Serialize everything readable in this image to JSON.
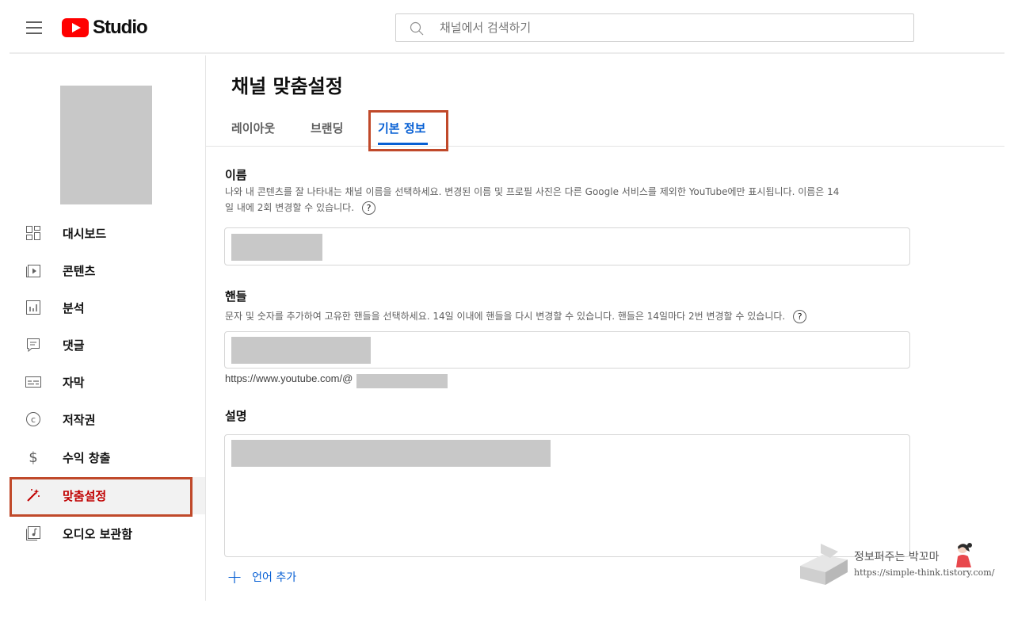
{
  "header": {
    "logo_text": "Studio",
    "search_placeholder": "채널에서 검색하기"
  },
  "sidebar": {
    "items": [
      {
        "label": "대시보드",
        "icon": "dashboard-icon"
      },
      {
        "label": "콘텐츠",
        "icon": "content-icon"
      },
      {
        "label": "분석",
        "icon": "analytics-icon"
      },
      {
        "label": "댓글",
        "icon": "comments-icon"
      },
      {
        "label": "자막",
        "icon": "subtitles-icon"
      },
      {
        "label": "저작권",
        "icon": "copyright-icon"
      },
      {
        "label": "수익 창출",
        "icon": "monetization-icon"
      },
      {
        "label": "맞춤설정",
        "icon": "customization-icon",
        "active": true
      },
      {
        "label": "오디오 보관함",
        "icon": "audio-library-icon"
      }
    ]
  },
  "main": {
    "title": "채널 맞춤설정",
    "tabs": [
      {
        "label": "레이아웃"
      },
      {
        "label": "브랜딩"
      },
      {
        "label": "기본 정보",
        "active": true
      }
    ],
    "name_section": {
      "title": "이름",
      "description_line1": "나와 내 콘텐츠를 잘 나타내는 채널 이름을 선택하세요. 변경된 이름 및 프로필 사진은 다른 Google 서비스를 제외한 YouTube에만 표시됩니다. 이름은 14",
      "description_line2": "일 내에 2회 변경할 수 있습니다."
    },
    "handle_section": {
      "title": "핸들",
      "description": "문자 및 숫자를 추가하여 고유한 핸들을 선택하세요. 14일 이내에 핸들을 다시 변경할 수 있습니다. 핸들은 14일마다 2번 변경할 수 있습니다.",
      "url_prefix": "https://www.youtube.com/@"
    },
    "description_section": {
      "title": "설명"
    },
    "add_language_label": "언어 추가"
  },
  "watermark": {
    "name": "정보퍼주는 박꼬마",
    "url": "https://simple-think.tistory.com/"
  },
  "colors": {
    "brand_red": "#ff0000",
    "active_tab_blue": "#065fd4",
    "active_nav_red": "#c00000",
    "highlight_outline": "#c0492a"
  }
}
